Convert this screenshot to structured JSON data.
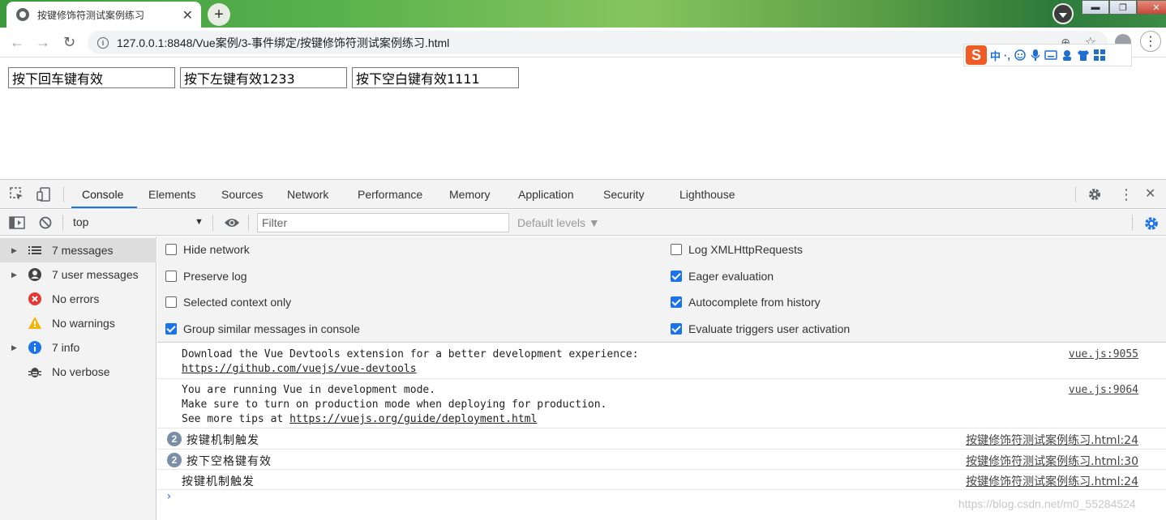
{
  "browser": {
    "tab_title": "按键修饰符测试案例练习",
    "tab_close": "✕",
    "new_tab": "+",
    "url": "127.0.0.1:8848/Vue案例/3-事件绑定/按键修饰符测试案例练习.html",
    "window_buttons": [
      "▬",
      "❐",
      "✕"
    ],
    "ime_items": [
      "中",
      "·,"
    ]
  },
  "page": {
    "inputs": [
      {
        "value": "按下回车键有效"
      },
      {
        "value": "按下左键有效1233"
      },
      {
        "value": "按下空白键有效1111"
      }
    ]
  },
  "devtools": {
    "tabs": [
      "Console",
      "Elements",
      "Sources",
      "Network",
      "Performance",
      "Memory",
      "Application",
      "Security",
      "Lighthouse"
    ],
    "active_tab": "Console",
    "context": "top",
    "filter_placeholder": "Filter",
    "levels_label": "Default levels ▼",
    "sidebar": [
      {
        "label": "7 messages",
        "icon": "list-icon",
        "expandable": true,
        "selected": true
      },
      {
        "label": "7 user messages",
        "icon": "user-icon",
        "expandable": true
      },
      {
        "label": "No errors",
        "icon": "error-icon",
        "expandable": false
      },
      {
        "label": "No warnings",
        "icon": "warning-icon",
        "expandable": false
      },
      {
        "label": "7 info",
        "icon": "info-icon",
        "expandable": true
      },
      {
        "label": "No verbose",
        "icon": "bug-icon",
        "expandable": false
      }
    ],
    "settings_left": [
      {
        "label": "Hide network",
        "checked": false
      },
      {
        "label": "Preserve log",
        "checked": false
      },
      {
        "label": "Selected context only",
        "checked": false
      },
      {
        "label": "Group similar messages in console",
        "checked": true
      }
    ],
    "settings_right": [
      {
        "label": "Log XMLHttpRequests",
        "checked": false
      },
      {
        "label": "Eager evaluation",
        "checked": true
      },
      {
        "label": "Autocomplete from history",
        "checked": true
      },
      {
        "label": "Evaluate triggers user activation",
        "checked": true
      }
    ],
    "messages": {
      "m1_line1": "Download the Vue Devtools extension for a better development experience:",
      "m1_link": "https://github.com/vuejs/vue-devtools",
      "m1_src": "vue.js:9055",
      "m2_line1": "You are running Vue in development mode.",
      "m2_line2": "Make sure to turn on production mode when deploying for production.",
      "m2_line3_prefix": "See more tips at ",
      "m2_link": "https://vuejs.org/guide/deployment.html",
      "m2_src": "vue.js:9064",
      "m3_count": "2",
      "m3_text": "按键机制触发",
      "m3_src": "按键修饰符测试案例练习.html:24",
      "m4_count": "2",
      "m4_text": "按下空格键有效",
      "m4_src": "按键修饰符测试案例练习.html:30",
      "m5_text": "按键机制触发",
      "m5_src": "按键修饰符测试案例练习.html:24"
    },
    "prompt": "›"
  },
  "watermark": "https://blog.csdn.net/m0_55284524",
  "colors": {
    "accent": "#1a73e8",
    "error": "#e53935",
    "warning": "#f4b400",
    "info": "#1a73e8"
  }
}
